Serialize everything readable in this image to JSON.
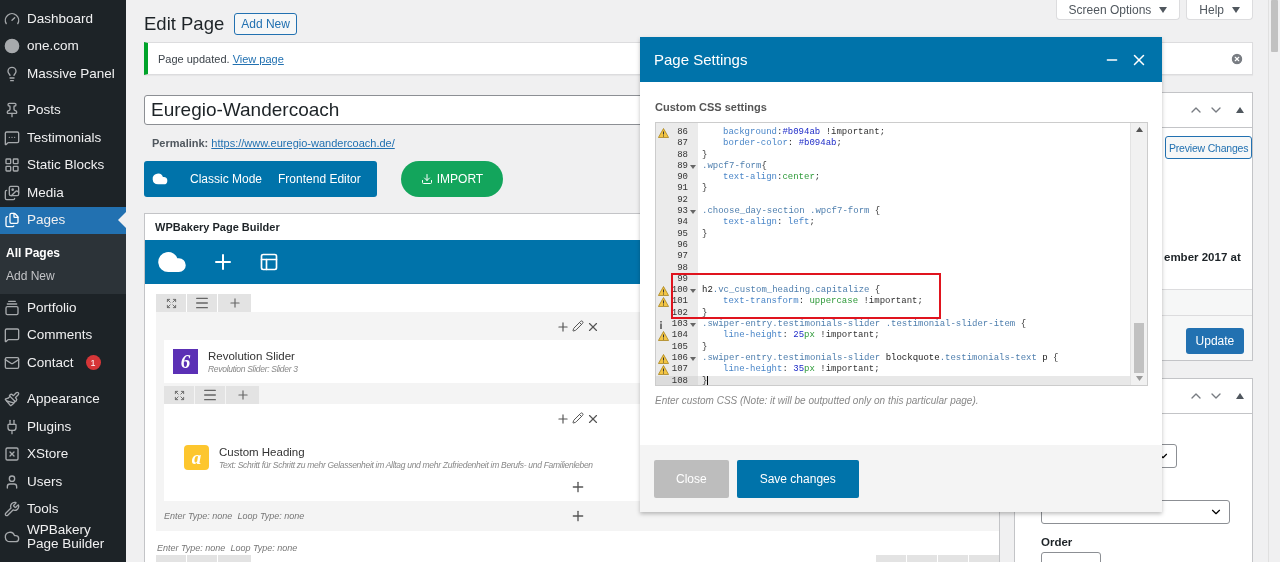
{
  "sidebar": {
    "groups": [
      [
        {
          "label": "Dashboard",
          "selected": false
        },
        {
          "label": "one.com",
          "selected": false
        },
        {
          "label": "Massive Panel",
          "selected": false
        }
      ],
      [
        {
          "label": "Posts",
          "selected": false
        },
        {
          "label": "Testimonials",
          "selected": false
        },
        {
          "label": "Static Blocks",
          "selected": false
        },
        {
          "label": "Media",
          "selected": false
        },
        {
          "label": "Pages",
          "selected": true,
          "children": [
            {
              "label": "All Pages",
              "selected": true
            },
            {
              "label": "Add New",
              "selected": false
            }
          ]
        },
        {
          "label": "Portfolio",
          "selected": false
        },
        {
          "label": "Comments",
          "selected": false
        },
        {
          "label": "Contact",
          "selected": false,
          "badge": "1"
        }
      ],
      [
        {
          "label": "Appearance",
          "selected": false
        },
        {
          "label": "Plugins",
          "selected": false
        },
        {
          "label": "XStore",
          "selected": false
        },
        {
          "label": "Users",
          "selected": false
        },
        {
          "label": "Tools",
          "selected": false
        },
        {
          "label": "WPBakery Page Builder",
          "selected": false
        }
      ]
    ]
  },
  "screen_tabs": [
    {
      "label": "Screen Options"
    },
    {
      "label": "Help"
    }
  ],
  "heading": {
    "title": "Edit Page",
    "button": "Add New"
  },
  "notice": {
    "text": "Page updated.",
    "link": "View page"
  },
  "title_field": {
    "value": "Euregio-Wandercoach"
  },
  "permalink": {
    "label": "Permalink:",
    "url": "https://www.euregio-wandercoach.de/"
  },
  "editor_buttons": [
    "Classic Mode",
    "Frontend Editor"
  ],
  "import_button": "IMPORT",
  "builder": {
    "title": "WPBakery Page Builder",
    "rows": [
      {
        "items": [
          {
            "kind": "element",
            "title": "Revolution Slider",
            "subtitle": "Revolution Slider: Slider 3",
            "badge": "6",
            "color": "#5b30b5"
          },
          {
            "kind": "inner_row",
            "items": [
              {
                "kind": "element",
                "title": "Custom Heading",
                "subtitle": "Text: Schritt für Schritt zu mehr Gelassenheit im Alltag und mehr Zufriedenheit im Berufs- und Familienleben",
                "badge": "a",
                "color": "#fdc62e"
              }
            ]
          }
        ],
        "column_footer": "Enter Type: none  Loop Type: none",
        "footer": "Enter Type: none  Loop Type: none"
      }
    ]
  },
  "publish": {
    "preview_button": "Preview Changes",
    "date_fragment": "ember 2017 at",
    "update_button": "Update"
  },
  "page_attributes": {
    "order_label": "Order"
  },
  "modal": {
    "title": "Page Settings",
    "section_label": "Custom CSS settings",
    "hint": "Enter custom CSS (Note: it will be outputted only on this particular page).",
    "code_groups": [
      {
        "highlighted": false,
        "lines": [
          {
            "num": "86",
            "kind": "warning",
            "fold": false,
            "active": false,
            "indent": true,
            "tokens": [
              {
                "kind": "prop",
                "text": "background"
              },
              {
                "kind": "punct",
                "text": ":"
              },
              {
                "kind": "hex",
                "text": "#b094ab"
              },
              {
                "kind": "imp",
                "text": " !important"
              },
              {
                "kind": "punct",
                "text": ";"
              }
            ]
          },
          {
            "num": "87",
            "kind": "plain",
            "fold": false,
            "active": false,
            "indent": true,
            "tokens": [
              {
                "kind": "prop",
                "text": "border-color"
              },
              {
                "kind": "punct",
                "text": ": "
              },
              {
                "kind": "hex",
                "text": "#b094ab"
              },
              {
                "kind": "punct",
                "text": ";"
              }
            ]
          },
          {
            "num": "88",
            "kind": "plain",
            "fold": false,
            "active": false,
            "indent": false,
            "tokens": [
              {
                "kind": "punct",
                "text": "}"
              }
            ]
          },
          {
            "num": "89",
            "kind": "plain",
            "fold": true,
            "active": false,
            "indent": false,
            "tokens": [
              {
                "kind": "sel",
                "text": ".wpcf7-form"
              },
              {
                "kind": "punct",
                "text": "{"
              }
            ]
          },
          {
            "num": "90",
            "kind": "plain",
            "fold": false,
            "active": false,
            "indent": true,
            "tokens": [
              {
                "kind": "prop",
                "text": "text-align"
              },
              {
                "kind": "punct",
                "text": ":"
              },
              {
                "kind": "val",
                "text": "center"
              },
              {
                "kind": "punct",
                "text": ";"
              }
            ]
          },
          {
            "num": "91",
            "kind": "plain",
            "fold": false,
            "active": false,
            "indent": false,
            "tokens": [
              {
                "kind": "punct",
                "text": "}"
              }
            ]
          },
          {
            "num": "92",
            "kind": "plain",
            "fold": false,
            "active": false
          },
          {
            "num": "93",
            "kind": "plain",
            "fold": true,
            "active": false,
            "indent": false,
            "tokens": [
              {
                "kind": "sel",
                "text": ".choose_day-section .wpcf7-form"
              },
              {
                "kind": "punct",
                "text": " {"
              }
            ]
          },
          {
            "num": "94",
            "kind": "plain",
            "fold": false,
            "active": false,
            "indent": true,
            "tokens": [
              {
                "kind": "prop",
                "text": "text-align"
              },
              {
                "kind": "punct",
                "text": ": "
              },
              {
                "kind": "kw",
                "text": "left"
              },
              {
                "kind": "punct",
                "text": ";"
              }
            ]
          },
          {
            "num": "95",
            "kind": "plain",
            "fold": false,
            "active": false,
            "indent": false,
            "tokens": [
              {
                "kind": "punct",
                "text": "}"
              }
            ]
          },
          {
            "num": "96",
            "kind": "plain",
            "fold": false,
            "active": false
          },
          {
            "num": "97",
            "kind": "plain",
            "fold": false,
            "active": false
          },
          {
            "num": "98",
            "kind": "plain",
            "fold": false,
            "active": false
          }
        ]
      },
      {
        "highlighted": true,
        "lines": [
          {
            "num": "99",
            "kind": "plain",
            "fold": false,
            "active": false
          },
          {
            "num": "100",
            "kind": "warning",
            "fold": true,
            "active": false,
            "indent": false,
            "tokens": [
              {
                "kind": "tag",
                "text": "h2"
              },
              {
                "kind": "sel",
                "text": ".vc_custom_heading.capitalize"
              },
              {
                "kind": "punct",
                "text": " {"
              }
            ]
          },
          {
            "num": "101",
            "kind": "warning",
            "fold": false,
            "active": false,
            "indent": true,
            "tokens": [
              {
                "kind": "prop",
                "text": "text-transform"
              },
              {
                "kind": "punct",
                "text": ": "
              },
              {
                "kind": "val",
                "text": "uppercase"
              },
              {
                "kind": "imp",
                "text": " !important"
              },
              {
                "kind": "punct",
                "text": ";"
              }
            ]
          },
          {
            "num": "102",
            "kind": "plain",
            "fold": false,
            "active": false,
            "indent": false,
            "tokens": [
              {
                "kind": "punct",
                "text": "}"
              }
            ]
          }
        ]
      },
      {
        "highlighted": false,
        "lines": [
          {
            "num": "103",
            "kind": "info",
            "fold": true,
            "active": false,
            "indent": false,
            "tokens": [
              {
                "kind": "sel",
                "text": ".swiper-entry.testimonials-slider .testimonial-slider-item"
              },
              {
                "kind": "punct",
                "text": " {"
              }
            ]
          },
          {
            "num": "104",
            "kind": "warning",
            "fold": false,
            "active": false,
            "indent": true,
            "tokens": [
              {
                "kind": "prop",
                "text": "line-height"
              },
              {
                "kind": "punct",
                "text": ": "
              },
              {
                "kind": "num",
                "text": "25"
              },
              {
                "kind": "unit",
                "text": "px"
              },
              {
                "kind": "imp",
                "text": " !important"
              },
              {
                "kind": "punct",
                "text": ";"
              }
            ]
          },
          {
            "num": "105",
            "kind": "plain",
            "fold": false,
            "active": false,
            "indent": false,
            "tokens": [
              {
                "kind": "punct",
                "text": "}"
              }
            ]
          },
          {
            "num": "106",
            "kind": "warning",
            "fold": true,
            "active": false,
            "indent": false,
            "tokens": [
              {
                "kind": "sel",
                "text": ".swiper-entry.testimonials-slider"
              },
              {
                "kind": "tag",
                "text": " blockquote"
              },
              {
                "kind": "sel",
                "text": ".testimonials-text"
              },
              {
                "kind": "tag",
                "text": " p "
              },
              {
                "kind": "punct",
                "text": "{"
              }
            ]
          },
          {
            "num": "107",
            "kind": "warning",
            "fold": false,
            "active": false,
            "indent": true,
            "tokens": [
              {
                "kind": "prop",
                "text": "line-height"
              },
              {
                "kind": "punct",
                "text": ": "
              },
              {
                "kind": "num",
                "text": "35"
              },
              {
                "kind": "unit",
                "text": "px"
              },
              {
                "kind": "imp",
                "text": " !important"
              },
              {
                "kind": "punct",
                "text": ";"
              }
            ]
          },
          {
            "num": "108",
            "kind": "plain",
            "fold": false,
            "active": true,
            "indent": false,
            "tokens": [
              {
                "kind": "punct",
                "text": "}"
              }
            ]
          }
        ]
      }
    ],
    "buttons": [
      {
        "label": "Close",
        "kind": "secondary"
      },
      {
        "label": "Save changes",
        "kind": "primary"
      }
    ]
  }
}
